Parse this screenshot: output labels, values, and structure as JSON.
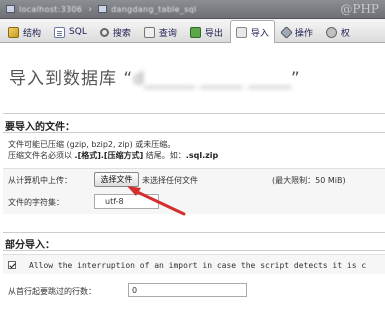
{
  "breadcrumb": {
    "items": [
      {
        "label": "localhost:3306",
        "icon": "server-icon"
      },
      {
        "label": "dangdang_table_sql",
        "icon": "database-icon"
      }
    ],
    "separator": "›",
    "watermark": "@PHP"
  },
  "tabs": [
    {
      "label": "结构",
      "icon": "structure-icon",
      "active": false
    },
    {
      "label": "SQL",
      "icon": "sql-icon",
      "active": false
    },
    {
      "label": "搜索",
      "icon": "search-icon",
      "active": false
    },
    {
      "label": "查询",
      "icon": "query-icon",
      "active": false
    },
    {
      "label": "导出",
      "icon": "export-icon",
      "active": false
    },
    {
      "label": "导入",
      "icon": "import-icon",
      "active": true
    },
    {
      "label": "操作",
      "icon": "operations-icon",
      "active": false
    },
    {
      "label": "权",
      "icon": "privileges-icon",
      "active": false
    }
  ],
  "page_title": {
    "prefix": "导入到数据库 “",
    "db_name": "d______ _____ _____",
    "suffix": "”"
  },
  "file_section": {
    "legend": "要导入的文件：",
    "line1": "文件可能已压缩 (gzip, bzip2, zip) 或未压缩。",
    "line2_prefix": "压缩文件名必须以 ",
    "line2_bold": ".[格式].[压缩方式]",
    "line2_mid": " 结尾。如：",
    "line2_example": ".sql.zip",
    "upload_label": "从计算机中上传：",
    "choose_button": "选择文件",
    "no_file_text": "未选择任何文件",
    "max_size": "(最大限制：50 MiB)",
    "charset_label": "文件的字符集：",
    "charset_value": "utf-8"
  },
  "partial_section": {
    "legend": "部分导入：",
    "allow_interrupt_text": "Allow the interruption of an import in case the script detects it is c",
    "skip_label": "从首行起要跳过的行数：",
    "skip_value": "0"
  },
  "colors": {
    "annotation_arrow": "#d32f2f"
  }
}
